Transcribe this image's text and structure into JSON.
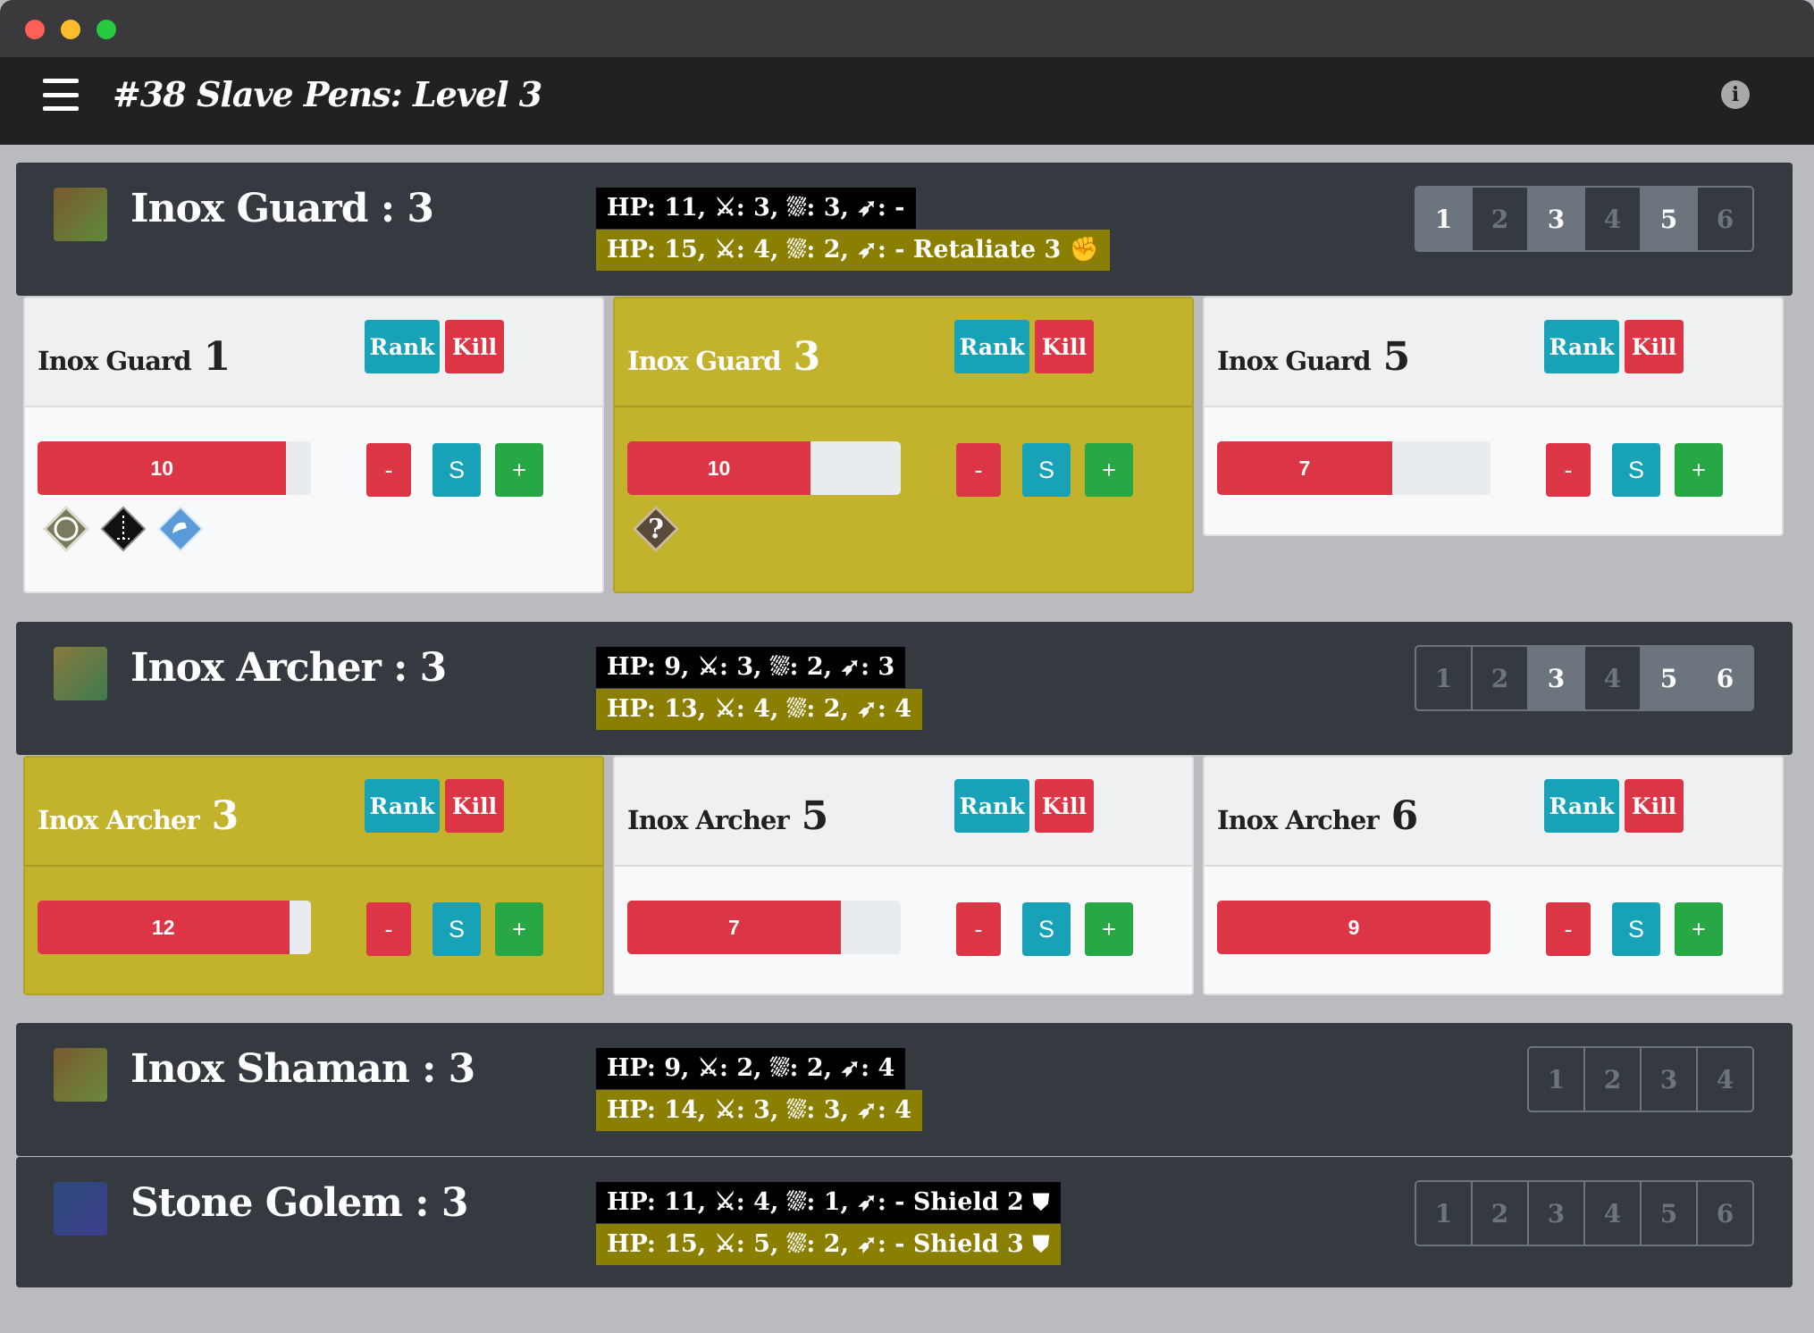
{
  "window": {
    "lights": [
      "#fe5f57",
      "#febc2e",
      "#28c840"
    ]
  },
  "navbar": {
    "title": "#38 Slave Pens: Level 3",
    "menu_icon": "hamburger-icon",
    "info_icon": "info-icon"
  },
  "stat_icons": {
    "attack": "sword-icon",
    "move": "boot-icon",
    "range": "bow-icon",
    "retaliate": "fist-icon",
    "shield": "shield-icon"
  },
  "monsters": [
    {
      "name": "Inox Guard : 3",
      "normal_stats": "HP: 11,  ⚔: 3,  ⛆: 3,  ➶: -",
      "elite_stats": "HP: 15,  ⚔: 4,  ⛆: 2,  ➶: -   Retaliate 3 ✊",
      "standees": [
        "1",
        "2",
        "3",
        "4",
        "5",
        "6"
      ],
      "active": [
        true,
        false,
        true,
        false,
        true,
        false
      ],
      "cards": [
        {
          "label": "Inox Guard",
          "number": "1",
          "elite": false,
          "hp": "10",
          "hp_fraction": 0.91,
          "rank": "Rank",
          "kill": "Kill",
          "minus": "-",
          "s": "S",
          "plus": "+",
          "conditions": [
            "disarm",
            "immobilize",
            "strengthen"
          ]
        },
        {
          "label": "Inox Guard",
          "number": "3",
          "elite": true,
          "hp": "10",
          "hp_fraction": 0.67,
          "rank": "Rank",
          "kill": "Kill",
          "minus": "-",
          "s": "S",
          "plus": "+",
          "conditions": [
            "unknown"
          ]
        },
        {
          "label": "Inox Guard",
          "number": "5",
          "elite": false,
          "hp": "7",
          "hp_fraction": 0.64,
          "rank": "Rank",
          "kill": "Kill",
          "minus": "-",
          "s": "S",
          "plus": "+",
          "conditions": []
        }
      ]
    },
    {
      "name": "Inox Archer : 3",
      "normal_stats": "HP: 9,  ⚔: 3,  ⛆: 2,  ➶: 3",
      "elite_stats": "HP: 13,  ⚔: 4,  ⛆: 2,  ➶: 4",
      "standees": [
        "1",
        "2",
        "3",
        "4",
        "5",
        "6"
      ],
      "active": [
        false,
        false,
        true,
        false,
        true,
        true
      ],
      "cards": [
        {
          "label": "Inox Archer",
          "number": "3",
          "elite": true,
          "hp": "12",
          "hp_fraction": 0.92,
          "rank": "Rank",
          "kill": "Kill",
          "minus": "-",
          "s": "S",
          "plus": "+",
          "conditions": []
        },
        {
          "label": "Inox Archer",
          "number": "5",
          "elite": false,
          "hp": "7",
          "hp_fraction": 0.78,
          "rank": "Rank",
          "kill": "Kill",
          "minus": "-",
          "s": "S",
          "plus": "+",
          "conditions": []
        },
        {
          "label": "Inox Archer",
          "number": "6",
          "elite": false,
          "hp": "9",
          "hp_fraction": 1.0,
          "rank": "Rank",
          "kill": "Kill",
          "minus": "-",
          "s": "S",
          "plus": "+",
          "conditions": []
        }
      ]
    },
    {
      "name": "Inox Shaman : 3",
      "normal_stats": "HP: 9,  ⚔: 2,  ⛆: 2,  ➶: 4",
      "elite_stats": "HP: 14,  ⚔: 3,  ⛆: 3,  ➶: 4",
      "standees": [
        "1",
        "2",
        "3",
        "4"
      ],
      "active": [
        false,
        false,
        false,
        false
      ],
      "cards": []
    },
    {
      "name": "Stone Golem : 3",
      "normal_stats": "HP: 11,  ⚔: 4,  ⛆: 1,  ➶: -   Shield 2 ⛊",
      "elite_stats": "HP: 15,  ⚔: 5,  ⛆: 2,  ➶: -   Shield 3 ⛊",
      "standees": [
        "1",
        "2",
        "3",
        "4",
        "5",
        "6"
      ],
      "active": [
        false,
        false,
        false,
        false,
        false,
        false
      ],
      "cards": []
    }
  ]
}
